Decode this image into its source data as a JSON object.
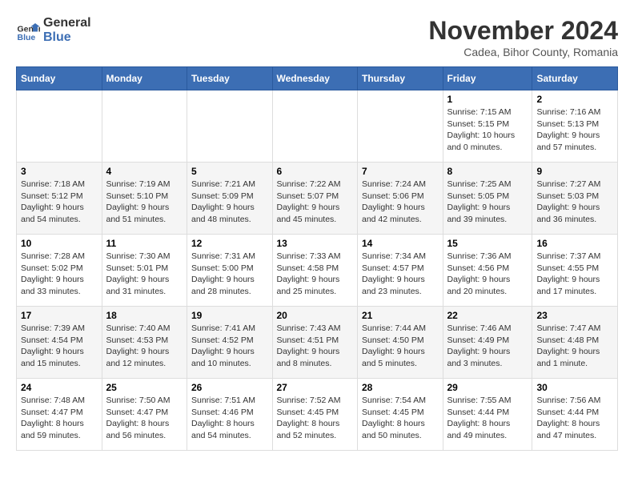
{
  "logo": {
    "line1": "General",
    "line2": "Blue"
  },
  "title": "November 2024",
  "subtitle": "Cadea, Bihor County, Romania",
  "days_of_week": [
    "Sunday",
    "Monday",
    "Tuesday",
    "Wednesday",
    "Thursday",
    "Friday",
    "Saturday"
  ],
  "weeks": [
    [
      {
        "day": "",
        "detail": ""
      },
      {
        "day": "",
        "detail": ""
      },
      {
        "day": "",
        "detail": ""
      },
      {
        "day": "",
        "detail": ""
      },
      {
        "day": "",
        "detail": ""
      },
      {
        "day": "1",
        "detail": "Sunrise: 7:15 AM\nSunset: 5:15 PM\nDaylight: 10 hours\nand 0 minutes."
      },
      {
        "day": "2",
        "detail": "Sunrise: 7:16 AM\nSunset: 5:13 PM\nDaylight: 9 hours\nand 57 minutes."
      }
    ],
    [
      {
        "day": "3",
        "detail": "Sunrise: 7:18 AM\nSunset: 5:12 PM\nDaylight: 9 hours\nand 54 minutes."
      },
      {
        "day": "4",
        "detail": "Sunrise: 7:19 AM\nSunset: 5:10 PM\nDaylight: 9 hours\nand 51 minutes."
      },
      {
        "day": "5",
        "detail": "Sunrise: 7:21 AM\nSunset: 5:09 PM\nDaylight: 9 hours\nand 48 minutes."
      },
      {
        "day": "6",
        "detail": "Sunrise: 7:22 AM\nSunset: 5:07 PM\nDaylight: 9 hours\nand 45 minutes."
      },
      {
        "day": "7",
        "detail": "Sunrise: 7:24 AM\nSunset: 5:06 PM\nDaylight: 9 hours\nand 42 minutes."
      },
      {
        "day": "8",
        "detail": "Sunrise: 7:25 AM\nSunset: 5:05 PM\nDaylight: 9 hours\nand 39 minutes."
      },
      {
        "day": "9",
        "detail": "Sunrise: 7:27 AM\nSunset: 5:03 PM\nDaylight: 9 hours\nand 36 minutes."
      }
    ],
    [
      {
        "day": "10",
        "detail": "Sunrise: 7:28 AM\nSunset: 5:02 PM\nDaylight: 9 hours\nand 33 minutes."
      },
      {
        "day": "11",
        "detail": "Sunrise: 7:30 AM\nSunset: 5:01 PM\nDaylight: 9 hours\nand 31 minutes."
      },
      {
        "day": "12",
        "detail": "Sunrise: 7:31 AM\nSunset: 5:00 PM\nDaylight: 9 hours\nand 28 minutes."
      },
      {
        "day": "13",
        "detail": "Sunrise: 7:33 AM\nSunset: 4:58 PM\nDaylight: 9 hours\nand 25 minutes."
      },
      {
        "day": "14",
        "detail": "Sunrise: 7:34 AM\nSunset: 4:57 PM\nDaylight: 9 hours\nand 23 minutes."
      },
      {
        "day": "15",
        "detail": "Sunrise: 7:36 AM\nSunset: 4:56 PM\nDaylight: 9 hours\nand 20 minutes."
      },
      {
        "day": "16",
        "detail": "Sunrise: 7:37 AM\nSunset: 4:55 PM\nDaylight: 9 hours\nand 17 minutes."
      }
    ],
    [
      {
        "day": "17",
        "detail": "Sunrise: 7:39 AM\nSunset: 4:54 PM\nDaylight: 9 hours\nand 15 minutes."
      },
      {
        "day": "18",
        "detail": "Sunrise: 7:40 AM\nSunset: 4:53 PM\nDaylight: 9 hours\nand 12 minutes."
      },
      {
        "day": "19",
        "detail": "Sunrise: 7:41 AM\nSunset: 4:52 PM\nDaylight: 9 hours\nand 10 minutes."
      },
      {
        "day": "20",
        "detail": "Sunrise: 7:43 AM\nSunset: 4:51 PM\nDaylight: 9 hours\nand 8 minutes."
      },
      {
        "day": "21",
        "detail": "Sunrise: 7:44 AM\nSunset: 4:50 PM\nDaylight: 9 hours\nand 5 minutes."
      },
      {
        "day": "22",
        "detail": "Sunrise: 7:46 AM\nSunset: 4:49 PM\nDaylight: 9 hours\nand 3 minutes."
      },
      {
        "day": "23",
        "detail": "Sunrise: 7:47 AM\nSunset: 4:48 PM\nDaylight: 9 hours\nand 1 minute."
      }
    ],
    [
      {
        "day": "24",
        "detail": "Sunrise: 7:48 AM\nSunset: 4:47 PM\nDaylight: 8 hours\nand 59 minutes."
      },
      {
        "day": "25",
        "detail": "Sunrise: 7:50 AM\nSunset: 4:47 PM\nDaylight: 8 hours\nand 56 minutes."
      },
      {
        "day": "26",
        "detail": "Sunrise: 7:51 AM\nSunset: 4:46 PM\nDaylight: 8 hours\nand 54 minutes."
      },
      {
        "day": "27",
        "detail": "Sunrise: 7:52 AM\nSunset: 4:45 PM\nDaylight: 8 hours\nand 52 minutes."
      },
      {
        "day": "28",
        "detail": "Sunrise: 7:54 AM\nSunset: 4:45 PM\nDaylight: 8 hours\nand 50 minutes."
      },
      {
        "day": "29",
        "detail": "Sunrise: 7:55 AM\nSunset: 4:44 PM\nDaylight: 8 hours\nand 49 minutes."
      },
      {
        "day": "30",
        "detail": "Sunrise: 7:56 AM\nSunset: 4:44 PM\nDaylight: 8 hours\nand 47 minutes."
      }
    ]
  ]
}
